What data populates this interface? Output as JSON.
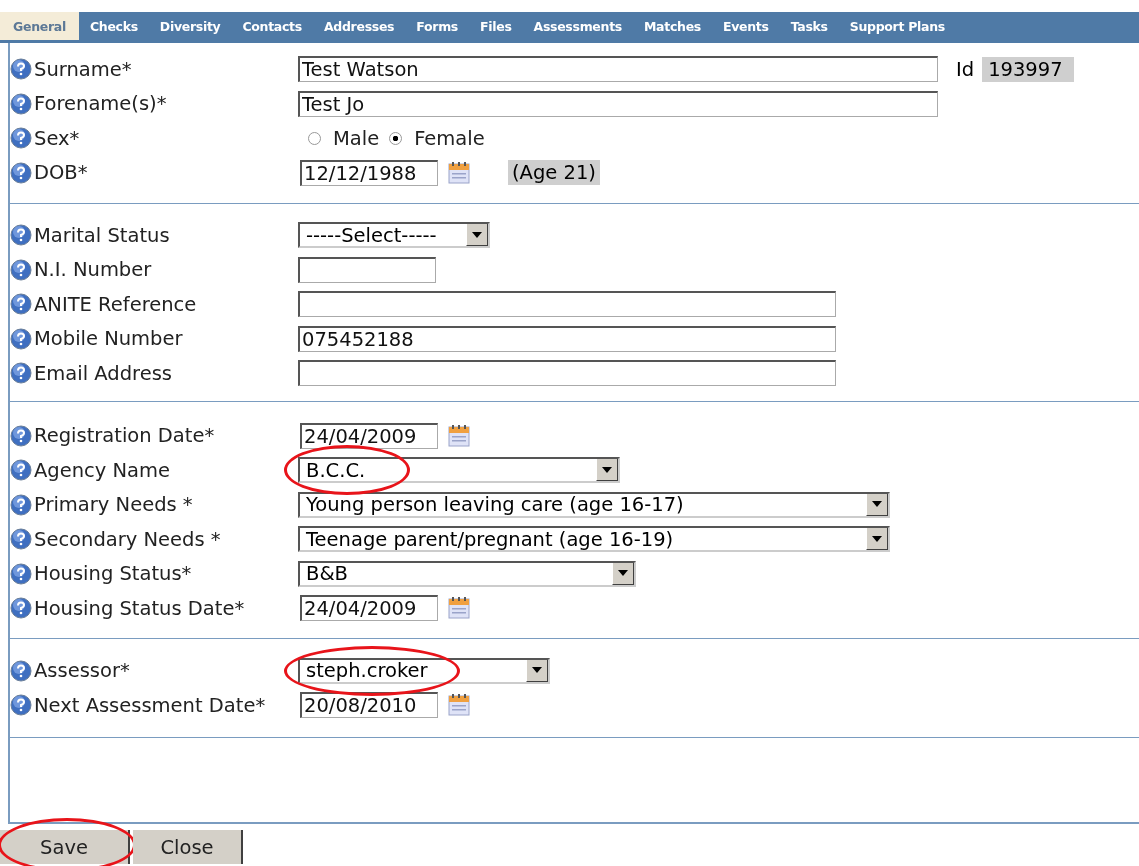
{
  "tabs": [
    {
      "label": "General",
      "selected": true
    },
    {
      "label": "Checks",
      "selected": false
    },
    {
      "label": "Diversity",
      "selected": false
    },
    {
      "label": "Contacts",
      "selected": false
    },
    {
      "label": "Addresses",
      "selected": false
    },
    {
      "label": "Forms",
      "selected": false
    },
    {
      "label": "Files",
      "selected": false
    },
    {
      "label": "Assessments",
      "selected": false
    },
    {
      "label": "Matches",
      "selected": false
    },
    {
      "label": "Events",
      "selected": false
    },
    {
      "label": "Tasks",
      "selected": false
    },
    {
      "label": "Support Plans",
      "selected": false
    }
  ],
  "sections": [
    {
      "rows": [
        {
          "kind": "text",
          "label": "Surname*",
          "value": "Test Watson",
          "id_label": "Id",
          "id_value": "193997"
        },
        {
          "kind": "text",
          "label": "Forename(s)*",
          "value": "Test Jo"
        },
        {
          "kind": "radio",
          "label": "Sex*",
          "options": [
            {
              "label": "Male",
              "selected": false
            },
            {
              "label": "Female",
              "selected": true
            }
          ]
        },
        {
          "kind": "date",
          "label": "DOB*",
          "value": "12/12/1988",
          "age": "(Age 21)"
        }
      ]
    },
    {
      "rows": [
        {
          "kind": "select",
          "label": "Marital Status",
          "value": "-----Select-----"
        },
        {
          "kind": "text",
          "label": "N.I. Number",
          "value": ""
        },
        {
          "kind": "text",
          "label": "ANITE Reference",
          "value": ""
        },
        {
          "kind": "text",
          "label": "Mobile Number",
          "value": "075452188"
        },
        {
          "kind": "text",
          "label": "Email Address",
          "value": ""
        }
      ]
    },
    {
      "rows": [
        {
          "kind": "date",
          "label": "Registration Date*",
          "value": "24/04/2009"
        },
        {
          "kind": "select",
          "label": "Agency Name",
          "value": "B.C.C.",
          "circled": true
        },
        {
          "kind": "select",
          "label": "Primary Needs *",
          "value": "Young person leaving care (age 16-17)"
        },
        {
          "kind": "select",
          "label": "Secondary Needs *",
          "value": "Teenage parent/pregnant (age 16-19)"
        },
        {
          "kind": "select",
          "label": "Housing Status*",
          "value": "B&B"
        },
        {
          "kind": "date",
          "label": "Housing Status Date*",
          "value": "24/04/2009"
        }
      ]
    },
    {
      "rows": [
        {
          "kind": "select",
          "label": "Assessor*",
          "value": "steph.croker",
          "circled": true
        },
        {
          "kind": "date",
          "label": "Next Assessment Date*",
          "value": "20/08/2010"
        }
      ]
    }
  ],
  "buttons": [
    {
      "label": "Save",
      "circled": true
    },
    {
      "label": "Close",
      "circled": false
    }
  ]
}
